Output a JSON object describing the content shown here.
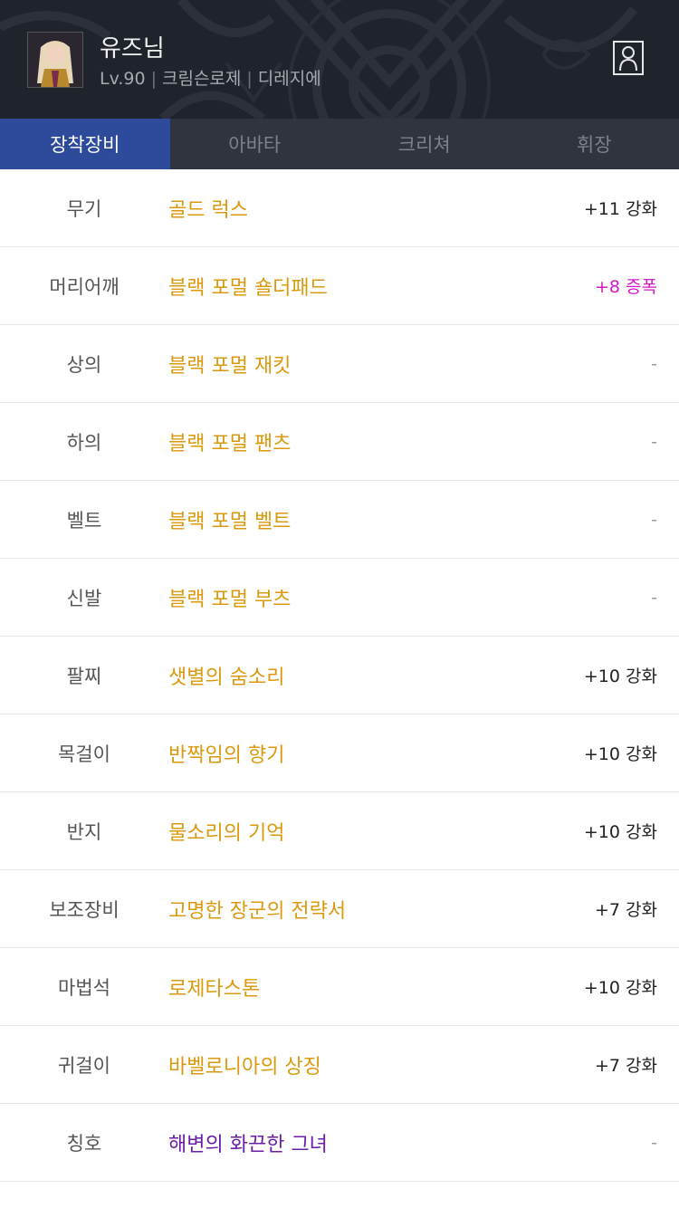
{
  "header": {
    "character_name": "유즈님",
    "level": "Lv.90",
    "job": "크림슨로제",
    "server": "디레지에",
    "profile_icon": "person-frame-icon"
  },
  "tabs": [
    {
      "label": "장착장비",
      "active": true
    },
    {
      "label": "아바타",
      "active": false
    },
    {
      "label": "크리쳐",
      "active": false
    },
    {
      "label": "휘장",
      "active": false
    }
  ],
  "equipment": [
    {
      "slot": "무기",
      "item": "골드 럭스",
      "enhance": "+11 강화",
      "item_color": "#d99a0f",
      "enhance_color": "#222222"
    },
    {
      "slot": "머리어깨",
      "item": "블랙 포멀 숄더패드",
      "enhance": "+8 증폭",
      "item_color": "#d99a0f",
      "enhance_color": "#d616c6"
    },
    {
      "slot": "상의",
      "item": "블랙 포멀 재킷",
      "enhance": "-",
      "item_color": "#d99a0f",
      "enhance_color": "#9a9a9a"
    },
    {
      "slot": "하의",
      "item": "블랙 포멀 팬츠",
      "enhance": "-",
      "item_color": "#d99a0f",
      "enhance_color": "#9a9a9a"
    },
    {
      "slot": "벨트",
      "item": "블랙 포멀 벨트",
      "enhance": "-",
      "item_color": "#d99a0f",
      "enhance_color": "#9a9a9a"
    },
    {
      "slot": "신발",
      "item": "블랙 포멀 부츠",
      "enhance": "-",
      "item_color": "#d99a0f",
      "enhance_color": "#9a9a9a"
    },
    {
      "slot": "팔찌",
      "item": "샛별의 숨소리",
      "enhance": "+10 강화",
      "item_color": "#d99a0f",
      "enhance_color": "#222222"
    },
    {
      "slot": "목걸이",
      "item": "반짝임의 향기",
      "enhance": "+10 강화",
      "item_color": "#d99a0f",
      "enhance_color": "#222222"
    },
    {
      "slot": "반지",
      "item": "물소리의 기억",
      "enhance": "+10 강화",
      "item_color": "#d99a0f",
      "enhance_color": "#222222"
    },
    {
      "slot": "보조장비",
      "item": "고명한 장군의 전략서",
      "enhance": "+7 강화",
      "item_color": "#d99a0f",
      "enhance_color": "#222222"
    },
    {
      "slot": "마법석",
      "item": "로제타스톤",
      "enhance": "+10 강화",
      "item_color": "#d99a0f",
      "enhance_color": "#222222"
    },
    {
      "slot": "귀걸이",
      "item": "바벨로니아의 상징",
      "enhance": "+7 강화",
      "item_color": "#d99a0f",
      "enhance_color": "#222222"
    },
    {
      "slot": "칭호",
      "item": "해변의 화끈한 그녀",
      "enhance": "-",
      "item_color": "#6b1fa6",
      "enhance_color": "#9a9a9a"
    }
  ],
  "colors": {
    "header_bg": "#1f232c",
    "tab_bar_bg": "#2f343f",
    "tab_active_bg": "#2e4a9a",
    "epic_item": "#d99a0f",
    "unique_title": "#6b1fa6",
    "amplify": "#d616c6"
  }
}
